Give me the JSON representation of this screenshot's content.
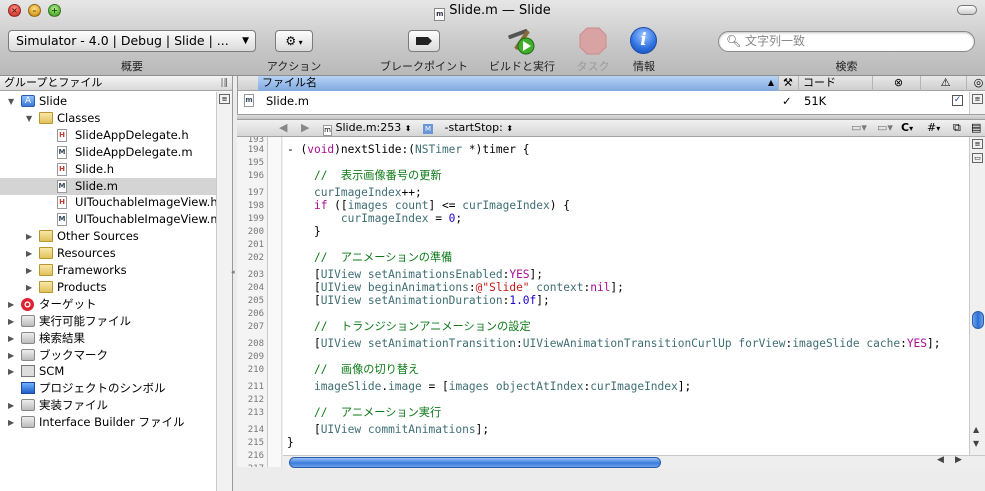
{
  "window": {
    "title": "Slide.m — Slide",
    "doc_icon_letter": "m"
  },
  "toolbar": {
    "scheme": "Simulator - 4.0 | Debug | Slide | ...",
    "overview_label": "概要",
    "action_label": "アクション",
    "breakpoint_label": "ブレークポイント",
    "build_run_label": "ビルドと実行",
    "task_label": "タスク",
    "info_label": "情報",
    "search_label": "検索",
    "search_placeholder": "文字列一致"
  },
  "sidebar": {
    "header": "グループとファイル",
    "items": [
      {
        "label": "Slide",
        "type": "project",
        "indent": 0,
        "expanded": true
      },
      {
        "label": "Classes",
        "type": "folder",
        "indent": 1,
        "expanded": true
      },
      {
        "label": "SlideAppDelegate.h",
        "type": "h",
        "indent": 2
      },
      {
        "label": "SlideAppDelegate.m",
        "type": "m",
        "indent": 2
      },
      {
        "label": "Slide.h",
        "type": "h",
        "indent": 2
      },
      {
        "label": "Slide.m",
        "type": "m",
        "indent": 2,
        "selected": true
      },
      {
        "label": "UITouchableImageView.h",
        "type": "h",
        "indent": 2
      },
      {
        "label": "UITouchableImageView.m",
        "type": "m",
        "indent": 2
      },
      {
        "label": "Other Sources",
        "type": "folder",
        "indent": 1
      },
      {
        "label": "Resources",
        "type": "folder",
        "indent": 1
      },
      {
        "label": "Frameworks",
        "type": "folder",
        "indent": 1
      },
      {
        "label": "Products",
        "type": "folder",
        "indent": 1
      },
      {
        "label": "ターゲット",
        "type": "target",
        "indent": 0
      },
      {
        "label": "実行可能ファイル",
        "type": "exec",
        "indent": 0
      },
      {
        "label": "検索結果",
        "type": "search",
        "indent": 0
      },
      {
        "label": "ブックマーク",
        "type": "bookmark",
        "indent": 0
      },
      {
        "label": "SCM",
        "type": "scm",
        "indent": 0
      },
      {
        "label": "プロジェクトのシンボル",
        "type": "symbols",
        "indent": 0,
        "no_triangle": true
      },
      {
        "label": "実装ファイル",
        "type": "impl",
        "indent": 0
      },
      {
        "label": "Interface Builder ファイル",
        "type": "ib",
        "indent": 0
      }
    ]
  },
  "filelist": {
    "columns": {
      "name": "ファイル名",
      "code": "コード"
    },
    "row": {
      "name": "Slide.m",
      "check": "✓",
      "code": "51K"
    }
  },
  "editor": {
    "file_popup": "Slide.m:253",
    "symbol_popup": "-startStop:",
    "c_menu": "C",
    "hash_menu": "#",
    "line_numbers": [
      "193",
      "194",
      "195",
      "196",
      "197",
      "198",
      "199",
      "200",
      "201",
      "202",
      "203",
      "204",
      "205",
      "206",
      "207",
      "208",
      "209",
      "210",
      "211",
      "212",
      "213",
      "214",
      "215",
      "216",
      "217"
    ]
  },
  "colors": {
    "comment": "#0e7a19",
    "keyword": "#aa0d91",
    "string": "#c41a16",
    "number": "#1c00cf",
    "identifier": "#3f6e74",
    "selection": "#d4d4d4"
  }
}
